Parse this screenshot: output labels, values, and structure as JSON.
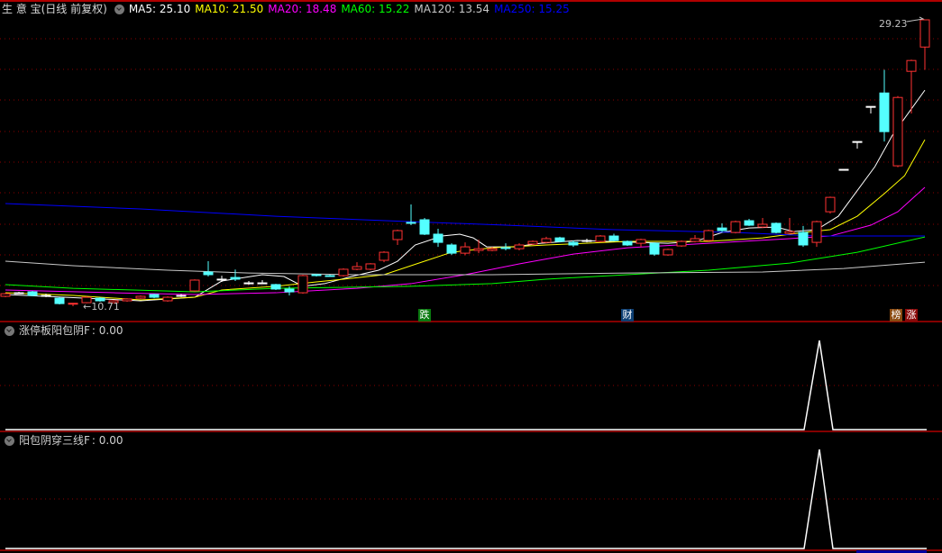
{
  "main": {
    "title": "生 意 宝(日线 前复权)",
    "ma_labels": [
      {
        "text": "MA5: 25.10",
        "color": "#ffffff"
      },
      {
        "text": "MA10: 21.50",
        "color": "#ffff00"
      },
      {
        "text": "MA20: 18.48",
        "color": "#ff00ff"
      },
      {
        "text": "MA60: 15.22",
        "color": "#00ff00"
      },
      {
        "text": "MA120: 13.54",
        "color": "#c8c8c8"
      },
      {
        "text": "MA250: 15.25",
        "color": "#0000ff"
      }
    ],
    "high_label": "29.23",
    "low_label": "←10.71",
    "markers": [
      {
        "text": "跌",
        "color": "#0a7a10",
        "index": 31
      },
      {
        "text": "财",
        "color": "#0d3f73",
        "index": 46
      },
      {
        "text": "榜",
        "color": "#8a4a10",
        "index": 66
      },
      {
        "text": "涨",
        "color": "#8a0a0a",
        "index": 67
      }
    ],
    "colors": {
      "up": "#ff3232",
      "down": "#54ffff",
      "flat": "#ffffff",
      "grid": "#8b0000",
      "border": "#b00000"
    },
    "candles": [
      [
        11.35,
        11.58,
        11.29,
        11.52
      ],
      [
        11.58,
        11.64,
        11.52,
        11.58
      ],
      [
        11.64,
        11.7,
        11.35,
        11.41
      ],
      [
        11.41,
        11.52,
        11.29,
        11.41
      ],
      [
        11.23,
        11.29,
        10.83,
        10.88
      ],
      [
        10.86,
        10.92,
        10.71,
        10.9
      ],
      [
        10.94,
        11.35,
        10.9,
        11.29
      ],
      [
        11.23,
        11.29,
        11.0,
        11.06
      ],
      [
        10.94,
        11.1,
        10.9,
        11.06
      ],
      [
        11.06,
        11.23,
        11.0,
        11.18
      ],
      [
        11.23,
        11.41,
        11.18,
        11.35
      ],
      [
        11.47,
        11.52,
        11.23,
        11.29
      ],
      [
        11.06,
        11.35,
        11.0,
        11.29
      ],
      [
        11.41,
        11.5,
        11.3,
        11.41
      ],
      [
        11.7,
        12.45,
        11.64,
        12.4
      ],
      [
        12.92,
        13.62,
        12.63,
        12.75
      ],
      [
        12.46,
        12.68,
        12.28,
        12.46
      ],
      [
        12.57,
        13.08,
        12.34,
        12.46
      ],
      [
        12.22,
        12.34,
        12.1,
        12.22
      ],
      [
        12.22,
        12.4,
        12.16,
        12.22
      ],
      [
        12.11,
        12.16,
        11.76,
        11.82
      ],
      [
        11.82,
        12.0,
        11.41,
        11.64
      ],
      [
        11.58,
        12.75,
        11.52,
        12.69
      ],
      [
        12.75,
        12.8,
        12.63,
        12.69
      ],
      [
        12.69,
        12.75,
        12.6,
        12.66
      ],
      [
        12.69,
        13.16,
        12.63,
        13.1
      ],
      [
        13.1,
        13.56,
        13.04,
        13.27
      ],
      [
        13.1,
        13.5,
        13.04,
        13.45
      ],
      [
        13.68,
        14.26,
        13.56,
        14.2
      ],
      [
        15.02,
        15.66,
        14.67,
        15.6
      ],
      [
        16.13,
        17.29,
        15.95,
        16.07
      ],
      [
        16.3,
        16.42,
        15.31,
        15.37
      ],
      [
        15.37,
        15.72,
        14.55,
        14.84
      ],
      [
        14.67,
        14.78,
        14.02,
        14.14
      ],
      [
        14.14,
        14.84,
        14.0,
        14.55
      ],
      [
        14.32,
        15.02,
        14.14,
        14.43
      ],
      [
        14.32,
        14.55,
        14.26,
        14.43
      ],
      [
        14.5,
        14.78,
        14.32,
        14.49
      ],
      [
        14.43,
        14.78,
        14.32,
        14.67
      ],
      [
        14.73,
        14.96,
        14.67,
        14.9
      ],
      [
        14.84,
        15.2,
        14.78,
        15.08
      ],
      [
        15.13,
        15.2,
        14.84,
        14.9
      ],
      [
        14.84,
        14.96,
        14.55,
        14.67
      ],
      [
        14.96,
        15.08,
        14.84,
        14.96
      ],
      [
        14.9,
        15.31,
        14.84,
        15.25
      ],
      [
        15.25,
        15.4,
        14.9,
        14.96
      ],
      [
        14.9,
        14.96,
        14.61,
        14.67
      ],
      [
        14.78,
        15.08,
        14.55,
        15.02
      ],
      [
        14.78,
        14.84,
        13.97,
        14.08
      ],
      [
        14.03,
        14.43,
        13.97,
        14.38
      ],
      [
        14.61,
        14.96,
        14.55,
        14.9
      ],
      [
        14.9,
        15.31,
        14.84,
        15.08
      ],
      [
        14.96,
        15.66,
        14.9,
        15.6
      ],
      [
        15.77,
        16.07,
        15.5,
        15.6
      ],
      [
        15.48,
        16.24,
        15.42,
        16.18
      ],
      [
        16.24,
        16.36,
        15.9,
        15.95
      ],
      [
        15.83,
        16.42,
        15.77,
        16.01
      ],
      [
        16.07,
        16.13,
        15.42,
        15.48
      ],
      [
        15.42,
        16.42,
        15.37,
        15.54
      ],
      [
        15.48,
        15.9,
        14.55,
        14.67
      ],
      [
        14.84,
        16.24,
        14.55,
        16.18
      ],
      [
        16.82,
        17.8,
        16.7,
        17.75
      ],
      [
        19.56,
        19.56,
        19.56,
        19.56
      ],
      [
        21.36,
        21.36,
        20.9,
        21.36
      ],
      [
        23.63,
        23.63,
        23.17,
        23.63
      ],
      [
        24.5,
        26.0,
        21.36,
        22.0
      ],
      [
        19.79,
        24.3,
        19.7,
        24.21
      ],
      [
        25.9,
        26.65,
        23.17,
        26.6
      ],
      [
        27.47,
        29.23,
        26.0,
        29.23
      ]
    ],
    "ma_lines": [
      {
        "name": "MA5",
        "color": "#ffffff",
        "points": [
          [
            0,
            11.47
          ],
          [
            10,
            11.06
          ],
          [
            14,
            11.29
          ],
          [
            16,
            12.34
          ],
          [
            19,
            12.75
          ],
          [
            20.6,
            12.63
          ],
          [
            22,
            12.0
          ],
          [
            23.6,
            12.17
          ],
          [
            25.6,
            12.63
          ],
          [
            27.6,
            13.04
          ],
          [
            29,
            13.62
          ],
          [
            30.3,
            14.67
          ],
          [
            32.3,
            15.25
          ],
          [
            33.6,
            15.37
          ],
          [
            34.6,
            15.13
          ],
          [
            35.6,
            14.55
          ],
          [
            37.6,
            14.55
          ],
          [
            39.6,
            14.78
          ],
          [
            42.3,
            14.96
          ],
          [
            49,
            14.78
          ],
          [
            51,
            14.9
          ],
          [
            53,
            15.48
          ],
          [
            55,
            15.77
          ],
          [
            57,
            15.83
          ],
          [
            58.3,
            15.54
          ],
          [
            60,
            15.66
          ],
          [
            61.6,
            16.53
          ],
          [
            64.3,
            19.73
          ],
          [
            65.6,
            21.77
          ],
          [
            68,
            24.68
          ]
        ]
      },
      {
        "name": "MA10",
        "color": "#ffff00",
        "points": [
          [
            0,
            11.58
          ],
          [
            5,
            11.41
          ],
          [
            10,
            11.12
          ],
          [
            14,
            11.29
          ],
          [
            16,
            11.76
          ],
          [
            20,
            12.0
          ],
          [
            23,
            12.28
          ],
          [
            25,
            12.46
          ],
          [
            28,
            12.75
          ],
          [
            31,
            13.62
          ],
          [
            33,
            14.2
          ],
          [
            36,
            14.49
          ],
          [
            40,
            14.67
          ],
          [
            46,
            14.9
          ],
          [
            52,
            14.9
          ],
          [
            56,
            15.13
          ],
          [
            59,
            15.48
          ],
          [
            61,
            15.66
          ],
          [
            63,
            16.53
          ],
          [
            65,
            17.99
          ],
          [
            66.5,
            19.15
          ],
          [
            68,
            21.48
          ]
        ]
      },
      {
        "name": "MA20",
        "color": "#ff00ff",
        "points": [
          [
            0,
            11.76
          ],
          [
            8,
            11.58
          ],
          [
            14,
            11.47
          ],
          [
            20,
            11.58
          ],
          [
            26,
            11.87
          ],
          [
            30,
            12.17
          ],
          [
            34,
            12.75
          ],
          [
            38,
            13.45
          ],
          [
            42,
            14.08
          ],
          [
            46,
            14.49
          ],
          [
            52,
            14.78
          ],
          [
            58,
            15.08
          ],
          [
            61,
            15.25
          ],
          [
            64,
            15.95
          ],
          [
            66,
            16.82
          ],
          [
            68,
            18.4
          ]
        ]
      },
      {
        "name": "MA60",
        "color": "#00ff00",
        "points": [
          [
            0,
            12.11
          ],
          [
            5,
            11.87
          ],
          [
            14,
            11.64
          ],
          [
            20,
            11.87
          ],
          [
            30,
            12.0
          ],
          [
            36,
            12.17
          ],
          [
            40,
            12.46
          ],
          [
            46,
            12.75
          ],
          [
            52,
            13.04
          ],
          [
            58,
            13.5
          ],
          [
            63,
            14.2
          ],
          [
            68,
            15.19
          ]
        ]
      },
      {
        "name": "MA120",
        "color": "#c8c8c8",
        "points": [
          [
            0,
            13.62
          ],
          [
            5,
            13.33
          ],
          [
            12,
            13.04
          ],
          [
            18,
            12.86
          ],
          [
            26,
            12.75
          ],
          [
            36,
            12.75
          ],
          [
            46,
            12.86
          ],
          [
            56,
            12.92
          ],
          [
            62,
            13.15
          ],
          [
            68,
            13.56
          ]
        ]
      },
      {
        "name": "MA250",
        "color": "#0000ff",
        "points": [
          [
            0,
            17.35
          ],
          [
            10,
            17.0
          ],
          [
            20,
            16.53
          ],
          [
            30,
            16.18
          ],
          [
            37,
            15.95
          ],
          [
            45,
            15.66
          ],
          [
            54,
            15.48
          ],
          [
            60,
            15.25
          ],
          [
            68,
            15.25
          ]
        ]
      }
    ]
  },
  "sub1": {
    "title": "涨停板阳包阴F",
    "value_label": ": 0.00",
    "signal_index": 60
  },
  "sub2": {
    "title": "阳包阴穿三线F",
    "value_label": ": 0.00",
    "signal_index": 60
  }
}
